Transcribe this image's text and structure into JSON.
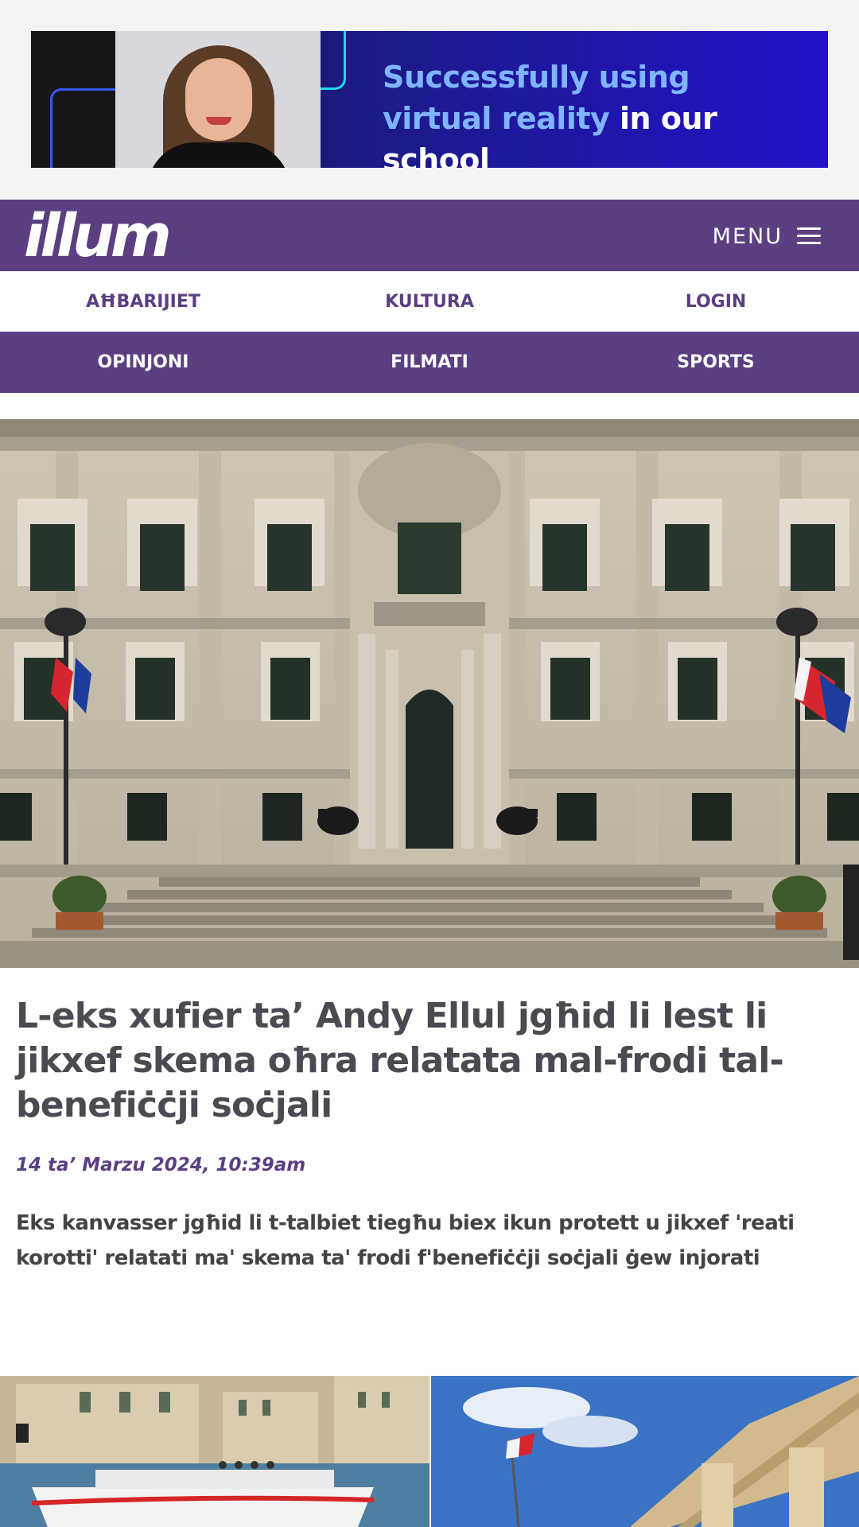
{
  "ad": {
    "headline_line1": "Successfully using",
    "headline_line2a": "virtual reality",
    "headline_line2b": " in our school"
  },
  "header": {
    "logo": "illum",
    "menu_label": "MENU"
  },
  "nav": {
    "row1": [
      "AĦBARIJIET",
      "KULTURA",
      "LOGIN"
    ],
    "row2": [
      "OPINJONI",
      "FILMATI",
      "SPORTS"
    ]
  },
  "article": {
    "headline": "L-eks xufier ta’ Andy Ellul jgħid li lest li jikxef skema oħra relatata mal-frodi tal-benefiċċji soċjali",
    "date": "14 ta’ Marzu 2024, 10:39am",
    "summary": "Eks kanvasser jgħid li t-talbiet tiegħu biex ikun protett u jikxef 'reati korotti' relatati ma' skema ta' frodi f'benefiċċji soċjali ġew injorati"
  },
  "colors": {
    "brand_purple": "#5b3f81",
    "ad_blue": "#2212c8",
    "ad_text_blue": "#7fb4ff"
  }
}
